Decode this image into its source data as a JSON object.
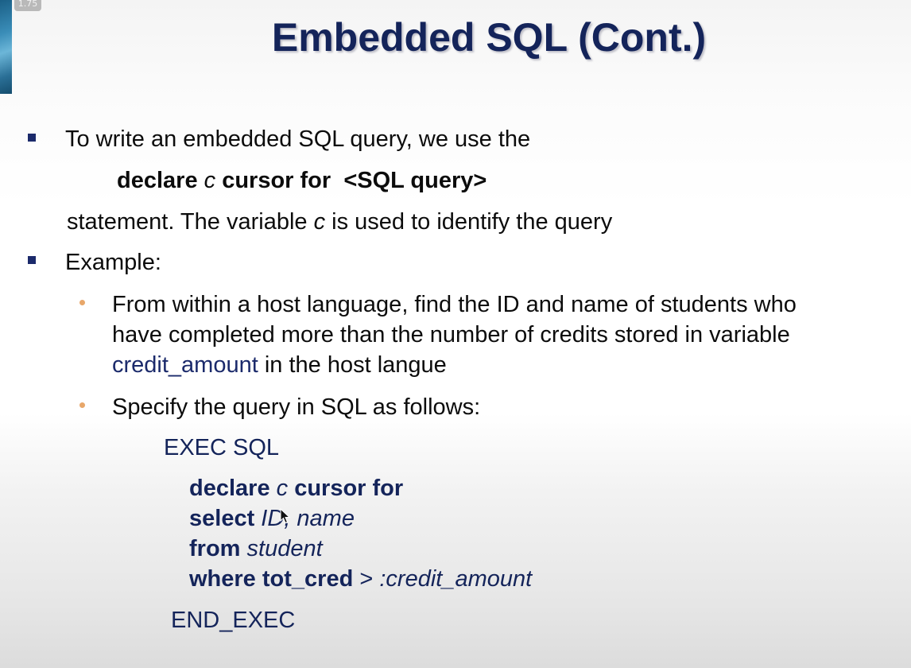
{
  "badge": {
    "speed": "1.75"
  },
  "title": "Embedded SQL (Cont.)",
  "bullet1": {
    "text": "To write an embedded SQL query, we use the",
    "stmt": {
      "kw1": "declare",
      "var": "c",
      "kw2": "cursor for",
      "query": "<SQL query>"
    },
    "cont_a": "statement.  The  variable",
    "cont_var": "c",
    "cont_b": "is used to identify the query"
  },
  "bullet2": {
    "text": "Example:",
    "sub1": {
      "line1": "From within a host language, find the ID and name of students who",
      "line2": "have completed more than the number of credits stored in variable",
      "line3_link": "credit_amount",
      "line3_rest": "in the host langue"
    },
    "sub2": {
      "text": "Specify the query in SQL as follows:"
    }
  },
  "code": {
    "exec": "EXEC SQL",
    "l1_kw": "declare",
    "l1_var": "c",
    "l1_kw2": "cursor for",
    "l2_kw": "select",
    "l2_rest": "ID, name",
    "l3_kw": "from",
    "l3_rest": "student",
    "l4_kw": "where tot_cred",
    "l4_op": ">",
    "l4_rest": ":credit_amount",
    "end": "END_EXEC"
  }
}
